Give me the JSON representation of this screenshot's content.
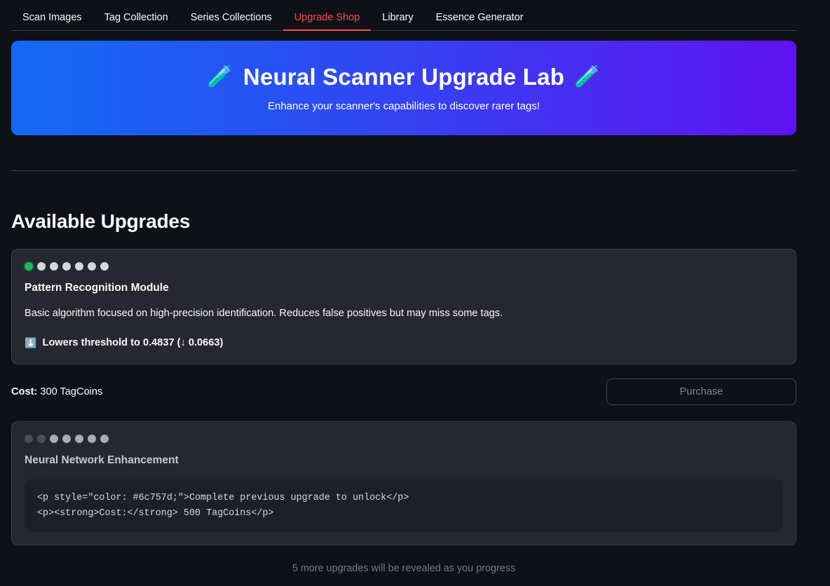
{
  "nav": {
    "tabs": [
      {
        "label": "Scan Images",
        "active": false
      },
      {
        "label": "Tag Collection",
        "active": false
      },
      {
        "label": "Series Collections",
        "active": false
      },
      {
        "label": "Upgrade Shop",
        "active": true
      },
      {
        "label": "Library",
        "active": false
      },
      {
        "label": "Essence Generator",
        "active": false
      }
    ],
    "active_color": "#ff4b4b"
  },
  "hero": {
    "emoji_left": "🧪",
    "emoji_right": "🧪",
    "title": "Neural Scanner Upgrade Lab",
    "subtitle": "Enhance your scanner's capabilities to discover rarer tags!",
    "gradient_from": "#1469f5",
    "gradient_to": "#5f12f0"
  },
  "section": {
    "heading": "Available Upgrades"
  },
  "upgrades": [
    {
      "dots": [
        "on",
        "off",
        "off",
        "off",
        "off",
        "off",
        "off"
      ],
      "title": "Pattern Recognition Module",
      "description": "Basic algorithm focused on high-precision identification. Reduces false positives but may miss some tags.",
      "effect_icon": "⬇️",
      "effect_text": "Lowers threshold to 0.4837 (↓ 0.0663)",
      "cost_label": "Cost:",
      "cost_value": "300 TagCoins",
      "purchase_label": "Purchase",
      "purchase_enabled": false
    },
    {
      "dots": [
        "dim-dark",
        "dim-dark",
        "dim-light",
        "dim-light",
        "dim-light",
        "dim-light",
        "dim-light"
      ],
      "title": "Neural Network Enhancement",
      "code_line_1": "<p style=\"color: #6c757d;\">Complete previous upgrade to unlock</p>",
      "code_line_2": "<p><strong>Cost:</strong> 500 TagCoins</p>"
    }
  ],
  "footer": {
    "note": "5 more upgrades will be revealed as you progress"
  }
}
